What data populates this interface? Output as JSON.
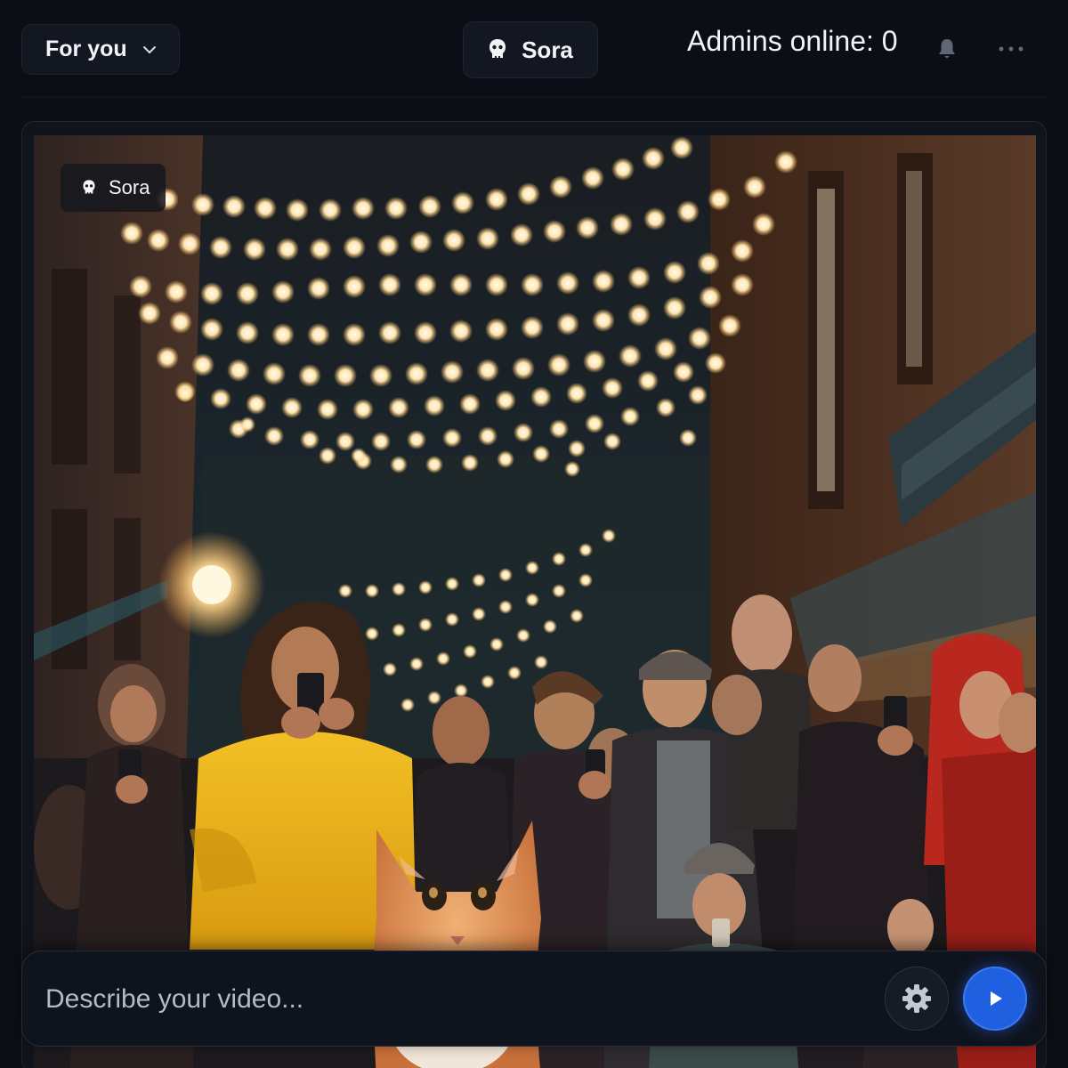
{
  "header": {
    "feed_selector": {
      "label": "For you",
      "icon": "chevron-down-icon"
    },
    "brand": {
      "label": "Sora",
      "icon": "ghost-icon"
    },
    "admins_online": "Admins online: 0",
    "notifications_icon": "bell-icon",
    "more_icon": "ellipsis-icon"
  },
  "video": {
    "badge_label": "Sora",
    "badge_icon": "ghost-icon"
  },
  "prompt": {
    "placeholder": "Describe your video...",
    "value": "",
    "settings_icon": "gear-icon",
    "submit_icon": "play-icon"
  },
  "colors": {
    "background": "#0b0e14",
    "panel": "#121722",
    "accent": "#1f5fe0",
    "coat_yellow": "#e9b21b",
    "cat_orange": "#d98a4e"
  }
}
